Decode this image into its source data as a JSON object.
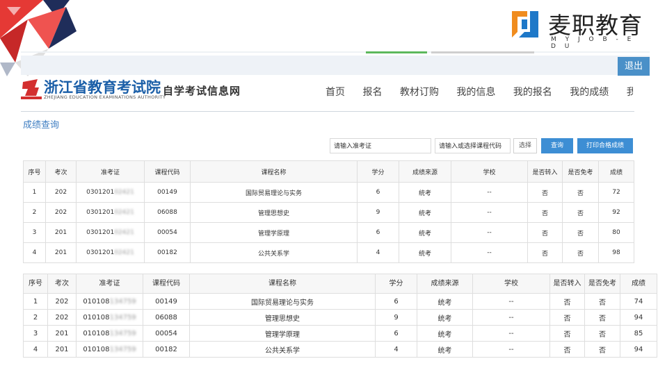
{
  "brand": {
    "name": "麦职教育",
    "sub": "M Y J O B - E D U"
  },
  "topbar": {
    "logout": "退出"
  },
  "site": {
    "title": "浙江省教育考试院",
    "subtitle": "ZHEJIANG EDUCATION EXAMINATIONS AUTHORITY",
    "tagline": "自学考试信息网"
  },
  "nav": [
    "首页",
    "报名",
    "教材订购",
    "我的信息",
    "我的报名",
    "我的成绩",
    "我的"
  ],
  "section_title": "成绩查询",
  "filters": {
    "exam_id_placeholder": "请输入准考证",
    "course_placeholder": "请输入或选择课程代码",
    "select_label": "选择",
    "query_label": "查询",
    "print_label": "打印合格成绩"
  },
  "table1": {
    "headers": [
      "序号",
      "考次",
      "准考证",
      "课程代码",
      "课程名称",
      "学分",
      "成绩来源",
      "学校",
      "是否转入",
      "是否免考",
      "成绩"
    ],
    "rows": [
      {
        "no": "1",
        "session": "202",
        "id_prefix": "0301201",
        "id_hidden": "02421",
        "code": "00149",
        "name": "国际贸易理论与实务",
        "credit": "6",
        "source": "统考",
        "school": "--",
        "transfer": "否",
        "exempt": "否",
        "score": "72"
      },
      {
        "no": "2",
        "session": "202",
        "id_prefix": "0301201",
        "id_hidden": "02421",
        "code": "06088",
        "name": "管理思想史",
        "credit": "9",
        "source": "统考",
        "school": "--",
        "transfer": "否",
        "exempt": "否",
        "score": "92"
      },
      {
        "no": "3",
        "session": "201",
        "id_prefix": "0301201",
        "id_hidden": "02421",
        "code": "00054",
        "name": "管理学原理",
        "credit": "6",
        "source": "统考",
        "school": "--",
        "transfer": "否",
        "exempt": "否",
        "score": "80"
      },
      {
        "no": "4",
        "session": "201",
        "id_prefix": "0301201",
        "id_hidden": "02421",
        "code": "00182",
        "name": "公共关系学",
        "credit": "4",
        "source": "统考",
        "school": "--",
        "transfer": "否",
        "exempt": "否",
        "score": "98"
      }
    ]
  },
  "table2": {
    "headers": [
      "序号",
      "考次",
      "准考证",
      "课程代码",
      "课程名称",
      "学分",
      "成绩来源",
      "学校",
      "是否转入",
      "是否免考",
      "成绩"
    ],
    "rows": [
      {
        "no": "1",
        "session": "202",
        "id_prefix": "010108",
        "id_hidden": "134759",
        "code": "00149",
        "name": "国际贸易理论与实务",
        "credit": "6",
        "source": "统考",
        "school": "--",
        "transfer": "否",
        "exempt": "否",
        "score": "74"
      },
      {
        "no": "2",
        "session": "202",
        "id_prefix": "010108",
        "id_hidden": "134759",
        "code": "06088",
        "name": "管理思想史",
        "credit": "9",
        "source": "统考",
        "school": "--",
        "transfer": "否",
        "exempt": "否",
        "score": "94"
      },
      {
        "no": "3",
        "session": "201",
        "id_prefix": "010108",
        "id_hidden": "134759",
        "code": "00054",
        "name": "管理学原理",
        "credit": "6",
        "source": "统考",
        "school": "--",
        "transfer": "否",
        "exempt": "否",
        "score": "85"
      },
      {
        "no": "4",
        "session": "201",
        "id_prefix": "010108",
        "id_hidden": "134759",
        "code": "00182",
        "name": "公共关系学",
        "credit": "4",
        "source": "统考",
        "school": "--",
        "transfer": "否",
        "exempt": "否",
        "score": "94"
      }
    ]
  },
  "colors": {
    "accent": "#3d8ed4",
    "site_title": "#1b5fa8",
    "deco_red": "#d9252f",
    "deco_navy": "#1f2d5a",
    "brand_orange": "#f08c1e",
    "brand_blue": "#1e78c8"
  }
}
